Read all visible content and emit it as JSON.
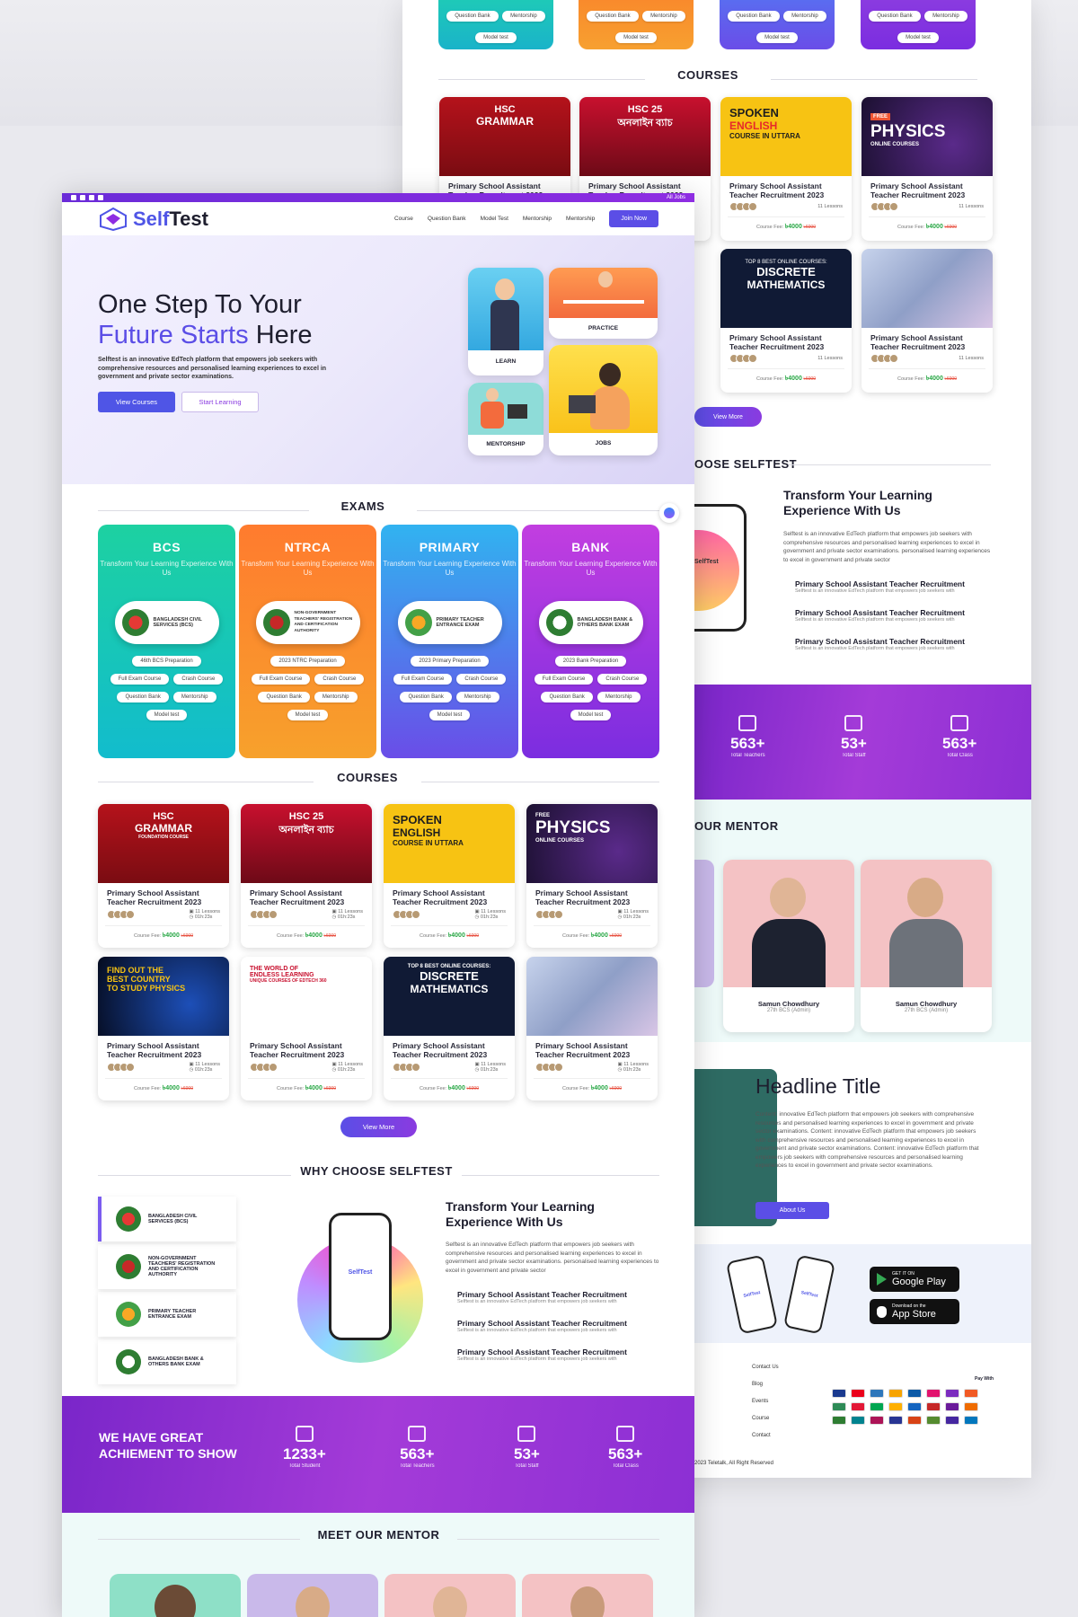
{
  "brand": {
    "name_a": "Self",
    "name_b": "Test",
    "accent": "#5b4ee6",
    "purple": "#8e2de2"
  },
  "topbar": {
    "jobs": "All Jobs"
  },
  "nav": {
    "items": [
      "Course",
      "Question Bank",
      "Model Test",
      "Mentorship",
      "Mentorship"
    ],
    "join": "Join Now"
  },
  "hero": {
    "line1": "One Step To Your",
    "line2a": "Future Starts",
    "line2b": "Here",
    "desc": "Selftest is an innovative EdTech platform that empowers job seekers with comprehensive resources and personalised learning experiences to excel in government and private sector examinations.",
    "btn_primary": "View Courses",
    "btn_secondary": "Start Learning",
    "tiles": [
      "LEARN",
      "PRACTICE",
      "MENTORSHIP",
      "JOBS"
    ]
  },
  "exams": {
    "title": "EXAMS",
    "tagline": "Transform Your Learning Experience With Us",
    "cards": [
      {
        "name": "BCS",
        "seal": "BANGLADESH CIVIL SERVICES (BCS)",
        "prep": "46th BCS Preparation",
        "pills": [
          "Full Exam Course",
          "Crash Course",
          "Question Bank",
          "Mentorship",
          "Model test"
        ]
      },
      {
        "name": "NTRCA",
        "seal": "NON-GOVERNMENT TEACHERS' REGISTRATION AND CERTIFICATION AUTHORITY",
        "prep": "2023 NTRC Preparation",
        "pills": [
          "Full Exam Course",
          "Crash Course",
          "Question Bank",
          "Mentorship",
          "Model test"
        ]
      },
      {
        "name": "PRIMARY",
        "seal": "PRIMARY TEACHER ENTRANCE EXAM",
        "prep": "2023 Primary Preparation",
        "pills": [
          "Full Exam Course",
          "Crash Course",
          "Question Bank",
          "Mentorship",
          "Model test"
        ]
      },
      {
        "name": "BANK",
        "seal": "BANGLADESH BANK & OTHERS BANK EXAM",
        "prep": "2023 Bank Preparation",
        "pills": [
          "Full Exam Course",
          "Crash Course",
          "Question Bank",
          "Mentorship",
          "Model test"
        ]
      }
    ],
    "back_pills": [
      "Question Bank",
      "Mentorship",
      "Model test"
    ]
  },
  "courses": {
    "title": "COURSES",
    "course_title": "Primary School Assistant Teacher Recruitment 2023",
    "lessons": "11 Lessons",
    "duration": "01h:23s",
    "fee_label": "Course Fee:",
    "fee": "৳4000",
    "old_fee": "৳6000",
    "view_more": "View More",
    "thumbs": [
      {
        "l1": "HSC",
        "l2": "GRAMMAR",
        "l3": "FOUNDATION COURSE"
      },
      {
        "l1": "HSC 25",
        "l2": "অনলাইন ব্যাচ",
        "l3": ""
      },
      {
        "l1": "SPOKEN",
        "l2": "ENGLISH",
        "l3": "COURSE IN UTTARA"
      },
      {
        "l1": "FREE",
        "l2": "PHYSICS",
        "l3": "ONLINE COURSES"
      },
      {
        "l1": "FIND OUT THE",
        "l2": "BEST COUNTRY",
        "l3": "TO STUDY PHYSICS"
      },
      {
        "l1": "THE WORLD OF",
        "l2": "ENDLESS LEARNING",
        "l3": "UNIQUE COURSES OF EDTECH 360"
      },
      {
        "l1": "TOP 8 BEST ONLINE COURSES:",
        "l2": "DISCRETE",
        "l3": "MATHEMATICS"
      },
      {
        "l1": "",
        "l2": "",
        "l3": ""
      }
    ]
  },
  "why": {
    "title": "WHY CHOOSE SELFTEST",
    "back_title": "OOSE SELFTEST",
    "tabs": [
      "BANGLADESH CIVIL SERVICES (BCS)",
      "NON-GOVERNMENT TEACHERS' REGISTRATION AND CERTIFICATION AUTHORITY",
      "PRIMARY TEACHER ENTRANCE EXAM",
      "BANGLADESH BANK & OTHERS BANK EXAM"
    ],
    "phone_logo": "SelfTest",
    "heading": "Transform Your Learning Experience With Us",
    "desc": "Selftest is an innovative EdTech platform that empowers job seekers with comprehensive resources and personalised learning experiences to excel in government and private sector examinations. personalised learning experiences to excel in government and private sector",
    "points": [
      "Primary School Assistant Teacher Recruitment",
      "Primary School Assistant Teacher Recruitment",
      "Primary School Assistant Teacher Recruitment"
    ],
    "point_sub": "Selftest is an innovative EdTech platform that empowers job seekers with"
  },
  "achievement": {
    "headline": "WE HAVE GREAT ACHIEMENT TO SHOW",
    "stats": [
      {
        "n": "1233+",
        "l": "Total Student"
      },
      {
        "n": "563+",
        "l": "Total Teachers"
      },
      {
        "n": "53+",
        "l": "Total Staff"
      },
      {
        "n": "563+",
        "l": "Total Class"
      }
    ]
  },
  "mentor": {
    "title": "MEET OUR MENTOR",
    "back_title": "OUR MENTOR",
    "people": [
      {
        "name": "Samun Chowdhury",
        "role": "27th BCS (Admin)"
      },
      {
        "name": "Samun Chowdhury",
        "role": "27th BCS (Admin)"
      }
    ]
  },
  "headline": {
    "title": "Headline Title",
    "body": "Content: innovative EdTech platform that empowers job seekers with comprehensive resources and personalised learning experiences to excel in government and private sector examinations. Content: innovative EdTech platform that empowers job seekers with comprehensive resources and personalised learning experiences to excel in government and private sector examinations. Content: innovative EdTech platform that empowers job seekers with comprehensive resources and personalised learning experiences to excel in government and private sector examinations.",
    "btn": "About Us"
  },
  "apps": {
    "gp_small": "GET IT ON",
    "gp_big": "Google Play",
    "as_small": "Download on the",
    "as_big": "App Store",
    "phone_logo": "SelfTest"
  },
  "footer": {
    "links": [
      "Contact Us",
      "Blog",
      "Events",
      "Course",
      "Contact"
    ],
    "paywith": "Pay With",
    "copyright": "2023 Teletalk, All Right Reserved",
    "pay_colors": [
      "#1a3a8f",
      "#eb001b",
      "#2e77bb",
      "#f7a400",
      "#0d5aa7",
      "#e2136e",
      "#7b2cbf",
      "#f15a24",
      "#2e8b57",
      "#e31837",
      "#00a651",
      "#ffb000",
      "#1565c0",
      "#c62828",
      "#6a1b9a",
      "#ef6c00",
      "#2e7d32",
      "#00838f",
      "#ad1457",
      "#283593",
      "#d84315",
      "#558b2f",
      "#4527a0",
      "#0277bd"
    ]
  }
}
